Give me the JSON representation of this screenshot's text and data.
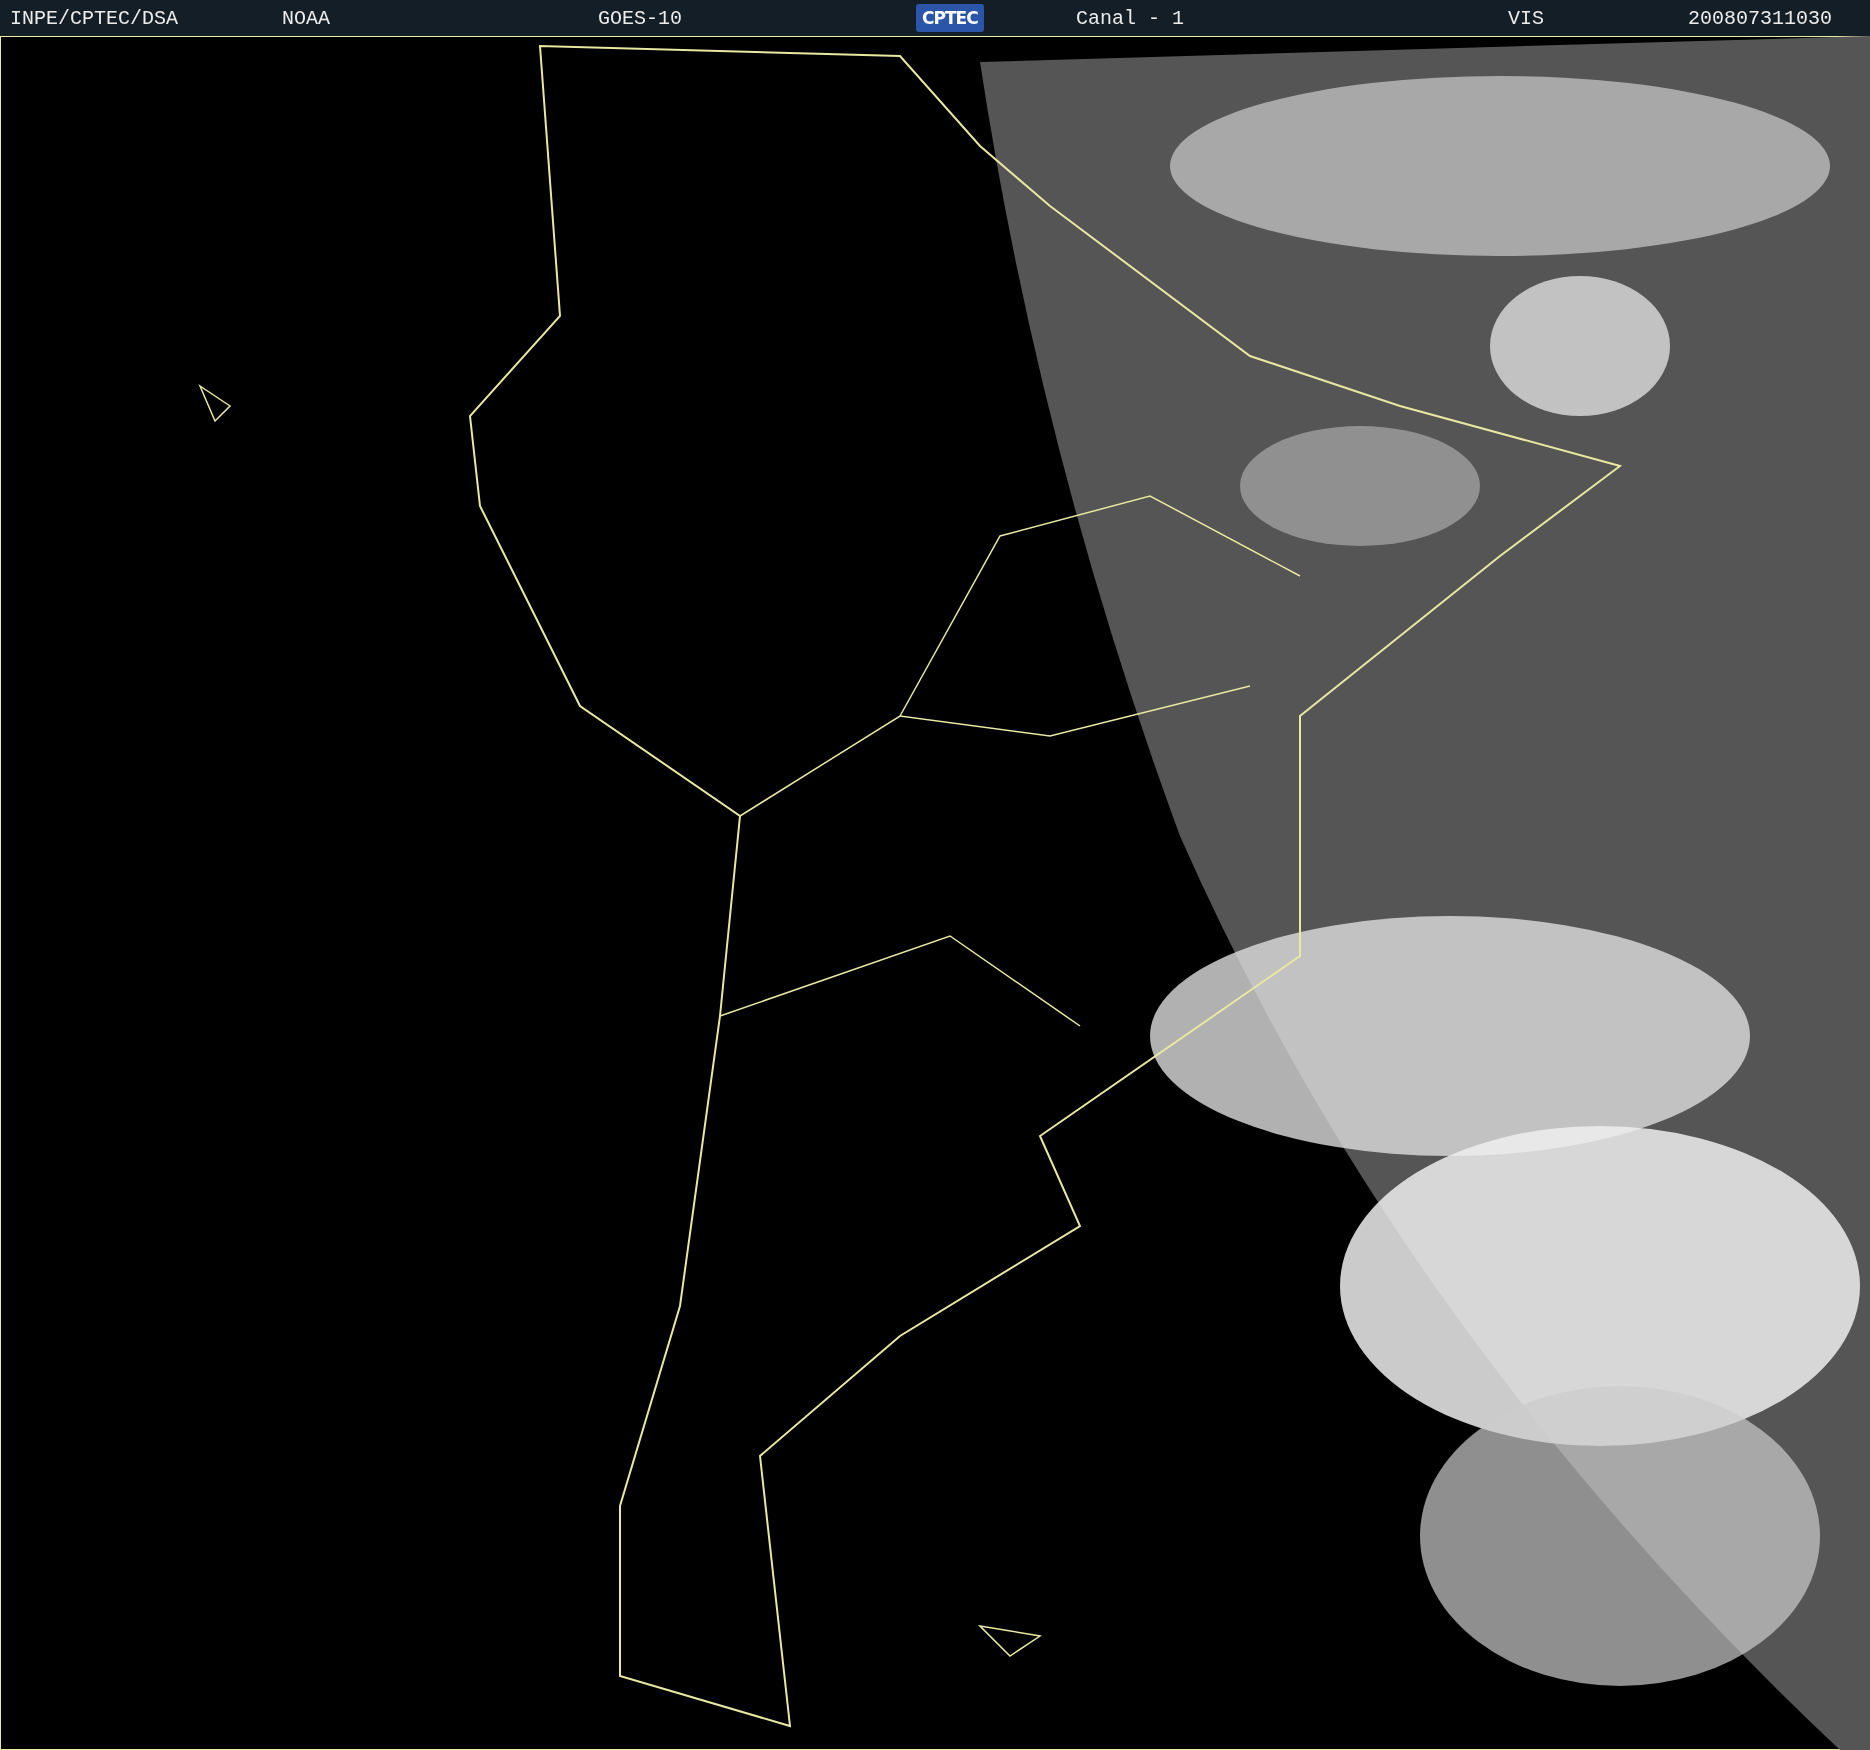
{
  "header": {
    "items": [
      {
        "text": "INPE/CPTEC/DSA"
      },
      {
        "text": "NOAA"
      },
      {
        "text": "GOES-10"
      },
      {
        "kind": "logo",
        "text": "CPTEC"
      },
      {
        "text": "Canal - 1"
      },
      {
        "text": "VIS"
      },
      {
        "text": "200807311030"
      }
    ]
  }
}
